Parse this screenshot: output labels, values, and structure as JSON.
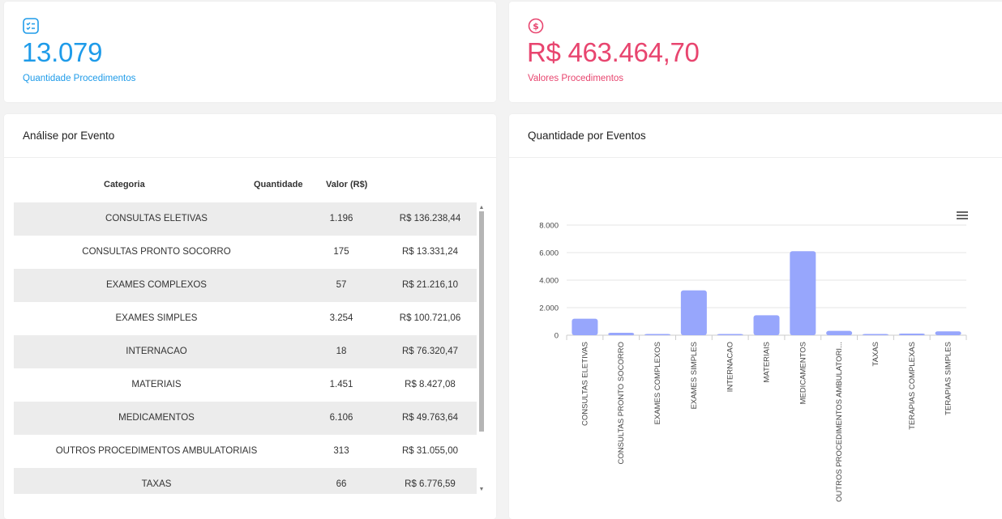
{
  "kpis": {
    "quantity": {
      "value": "13.079",
      "label": "Quantidade Procedimentos",
      "icon": "checklist-icon",
      "color": "#1e9be9"
    },
    "amount": {
      "value": "R$ 463.464,70",
      "label": "Valores Procedimentos",
      "icon": "dollar-circle-icon",
      "color": "#e8456f"
    }
  },
  "table_panel": {
    "title": "Análise por Evento",
    "headers": {
      "category": "Categoria",
      "quantity": "Quantidade",
      "value": "Valor (R$)"
    },
    "rows": [
      {
        "category": "CONSULTAS ELETIVAS",
        "quantity": "1.196",
        "value": "R$ 136.238,44"
      },
      {
        "category": "CONSULTAS PRONTO SOCORRO",
        "quantity": "175",
        "value": "R$ 13.331,24"
      },
      {
        "category": "EXAMES COMPLEXOS",
        "quantity": "57",
        "value": "R$ 21.216,10"
      },
      {
        "category": "EXAMES SIMPLES",
        "quantity": "3.254",
        "value": "R$ 100.721,06"
      },
      {
        "category": "INTERNACAO",
        "quantity": "18",
        "value": "R$ 76.320,47"
      },
      {
        "category": "MATERIAIS",
        "quantity": "1.451",
        "value": "R$ 8.427,08"
      },
      {
        "category": "MEDICAMENTOS",
        "quantity": "6.106",
        "value": "R$ 49.763,64"
      },
      {
        "category": "OUTROS PROCEDIMENTOS AMBULATORIAIS",
        "quantity": "313",
        "value": "R$ 31.055,00"
      },
      {
        "category": "TAXAS",
        "quantity": "66",
        "value": "R$ 6.776,59"
      }
    ]
  },
  "chart_panel": {
    "title": "Quantidade por Eventos",
    "menu_icon": "hamburger-menu-icon"
  },
  "chart_data": {
    "type": "bar",
    "categories": [
      "CONSULTAS ELETIVAS",
      "CONSULTAS PRONTO SOCORRO",
      "EXAMES COMPLEXOS",
      "EXAMES SIMPLES",
      "INTERNACAO",
      "MATERIAIS",
      "MEDICAMENTOS",
      "OUTROS PROCEDIMENTOS AMBULATORI...",
      "TAXAS",
      "TERAPIAS COMPLEXAS",
      "TERAPIAS SIMPLES"
    ],
    "values": [
      1196,
      175,
      57,
      3254,
      18,
      1451,
      6106,
      313,
      66,
      120,
      280
    ],
    "yticks": [
      "0",
      "2.000",
      "4.000",
      "6.000",
      "8.000"
    ],
    "ytick_values": [
      0,
      2000,
      4000,
      6000,
      8000
    ],
    "ylim": [
      0,
      8000
    ],
    "bar_color": "#97a6fc",
    "grid": true,
    "xlabel": "",
    "ylabel": ""
  }
}
